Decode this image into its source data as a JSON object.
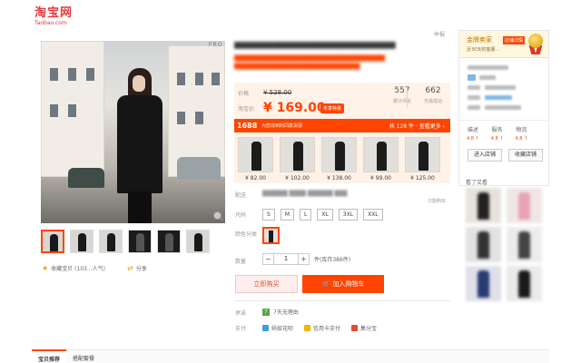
{
  "logo": {
    "cn": "淘宝网",
    "en": "Taobao.com"
  },
  "gallery": {
    "watermark": "FRO",
    "thumbnail_count": 6
  },
  "favorite": {
    "label": "收藏宝贝 (103...人气)"
  },
  "share": {
    "label": "分享"
  },
  "report_label": "举报",
  "price_box": {
    "price_label": "价格",
    "original_price": "¥ 528.00",
    "promo_label": "淘宝价",
    "current_price": "¥ 169.00",
    "season_tag": "冬季特惠",
    "reviews": {
      "value": "557",
      "label": "累计评论"
    },
    "sales": {
      "value": "662",
      "label": "交易成功"
    }
  },
  "promo_bar": {
    "number": "1688",
    "text": "为您找到的同款货源",
    "right": "共 128 件 · 查看更多 ›"
  },
  "skus": [
    {
      "price": "¥ 82.00"
    },
    {
      "price": "¥ 102.00"
    },
    {
      "price": "¥ 138.00"
    },
    {
      "price": "¥ 99.00"
    },
    {
      "price": "¥ 125.00"
    }
  ],
  "shipping": {
    "label": "配送",
    "only_tag": "只能购买"
  },
  "size": {
    "label": "尺码",
    "options": [
      "S",
      "M",
      "L",
      "XL",
      "3XL",
      "XXL"
    ]
  },
  "color": {
    "label": "颜色分类"
  },
  "quantity": {
    "label": "数量",
    "value": "1",
    "minus": "−",
    "plus": "+",
    "stock": "件(库存386件)"
  },
  "actions": {
    "buy_now": "立即购买",
    "add_to_cart": "加入购物车",
    "cart_icon": "cart-icon"
  },
  "promise": {
    "label": "承诺",
    "text": "7天无理由"
  },
  "payment": {
    "label": "支付",
    "methods": [
      {
        "name": "蚂蚁花呗",
        "color": "#3c9ee0"
      },
      {
        "name": "信用卡支付",
        "color": "#f5b400"
      },
      {
        "name": "集分宝",
        "color": "#e54a2f"
      }
    ]
  },
  "seller": {
    "badge_title": "金牌卖家",
    "badge_tag": "店铺详情",
    "badge_sub": "近30天的客服...",
    "ratings": [
      {
        "label": "描述",
        "value": "4.8 ↑"
      },
      {
        "label": "服务",
        "value": "4.8 ↑"
      },
      {
        "label": "物流",
        "value": "4.8 ↑"
      }
    ],
    "enter_store": "进入店铺",
    "favorite_store": "收藏店铺"
  },
  "see_also_label": "看了又看",
  "bottom_tabs": [
    {
      "label": "宝贝推荐"
    },
    {
      "label": "搭配套餐"
    }
  ],
  "colors": {
    "accent": "#ff4400",
    "brand": "#e4393c",
    "price_bg": "#fff2e8"
  }
}
